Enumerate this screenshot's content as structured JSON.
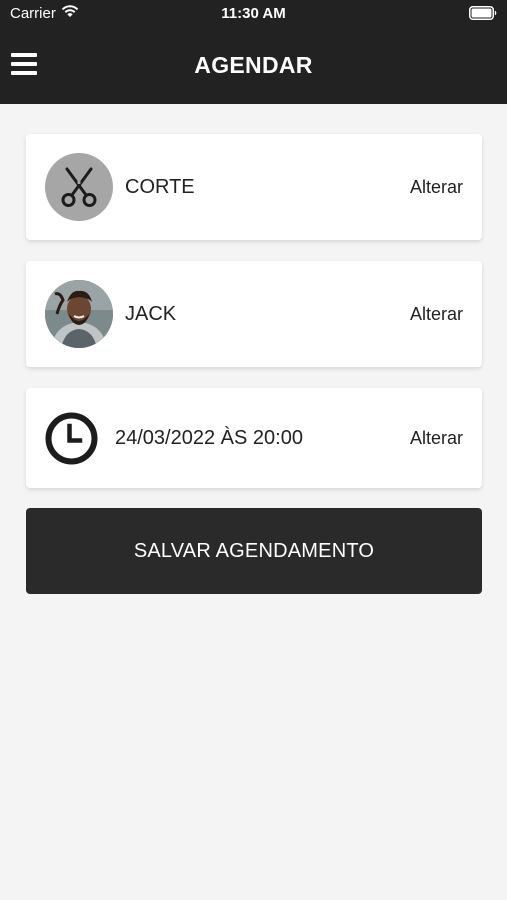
{
  "status_bar": {
    "carrier": "Carrier",
    "time": "11:30 AM",
    "wifi_icon": "wifi-icon",
    "battery_icon": "battery-icon"
  },
  "header": {
    "title": "AGENDAR",
    "menu_icon": "menu-icon"
  },
  "appointment": {
    "service": {
      "label": "CORTE",
      "change_label": "Alterar",
      "icon": "scissors-icon"
    },
    "barber": {
      "label": "JACK",
      "change_label": "Alterar",
      "avatar": "barber-avatar"
    },
    "datetime": {
      "label": "24/03/2022 ÀS 20:00",
      "change_label": "Alterar",
      "icon": "clock-icon"
    }
  },
  "save_button": {
    "label": "SALVAR AGENDAMENTO"
  },
  "colors": {
    "header_bg": "#222222",
    "page_bg": "#f4f4f4",
    "card_bg": "#ffffff",
    "button_bg": "#2a2a2a",
    "text": "#222222"
  }
}
